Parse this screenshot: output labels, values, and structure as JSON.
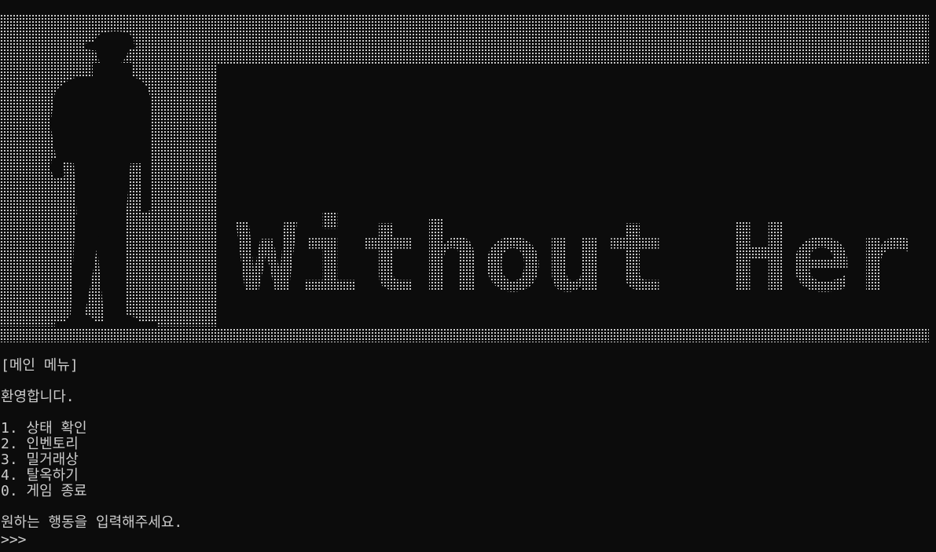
{
  "banner": {
    "title": "Without Her",
    "colors": {
      "dots": "#c8c8c8",
      "background": "#0c0c0c"
    },
    "icon": "silhouette-man-with-hat"
  },
  "menu": {
    "header": "[메인 메뉴]",
    "welcome": "환영합니다.",
    "items": [
      "1. 상태 확인",
      "2. 인벤토리",
      "3. 밀거래상",
      "4. 탈옥하기",
      "0. 게임 종료"
    ],
    "instruction": "원하는 행동을 입력해주세요.",
    "prompt": ">>>"
  }
}
